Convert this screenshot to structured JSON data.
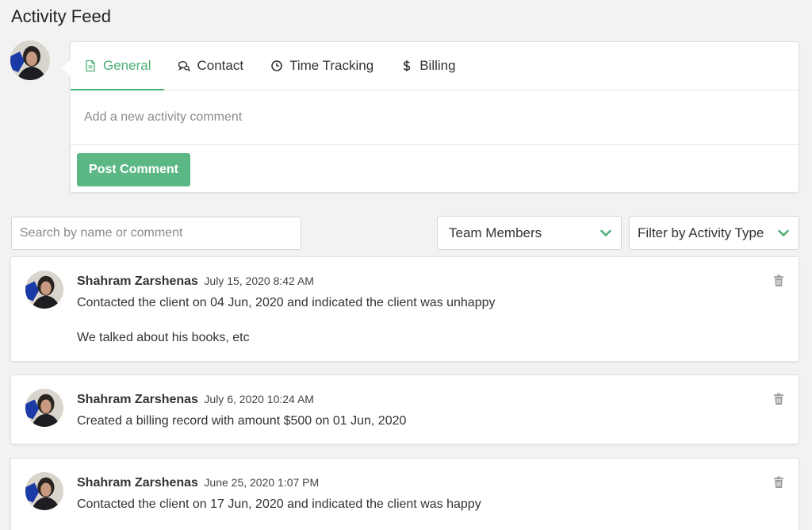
{
  "page": {
    "title": "Activity Feed"
  },
  "composer": {
    "tabs": [
      {
        "label": "General",
        "icon": "document-icon",
        "active": true
      },
      {
        "label": "Contact",
        "icon": "chat-icon",
        "active": false
      },
      {
        "label": "Time Tracking",
        "icon": "clock-icon",
        "active": false
      },
      {
        "label": "Billing",
        "icon": "dollar-icon",
        "active": false
      }
    ],
    "placeholder": "Add a new activity comment",
    "post_label": "Post Comment"
  },
  "filters": {
    "search_placeholder": "Search by name or comment",
    "team_label": "Team Members",
    "type_label": "Filter by Activity Type"
  },
  "colors": {
    "accent": "#4caf76",
    "button": "#5bb884",
    "chevron": "#4caf76",
    "trash": "#9e9e9e"
  },
  "activities": [
    {
      "author": "Shahram Zarshenas",
      "date": "July 15, 2020 8:42 AM",
      "lines": [
        "Contacted the client on 04 Jun, 2020 and indicated the client was unhappy",
        "We talked about his books, etc"
      ]
    },
    {
      "author": "Shahram Zarshenas",
      "date": "July 6, 2020 10:24 AM",
      "lines": [
        "Created a billing record with amount $500 on 01 Jun, 2020"
      ]
    },
    {
      "author": "Shahram Zarshenas",
      "date": "June 25, 2020 1:07 PM",
      "lines": [
        "Contacted the client on 17 Jun, 2020 and indicated the client was happy"
      ]
    }
  ]
}
